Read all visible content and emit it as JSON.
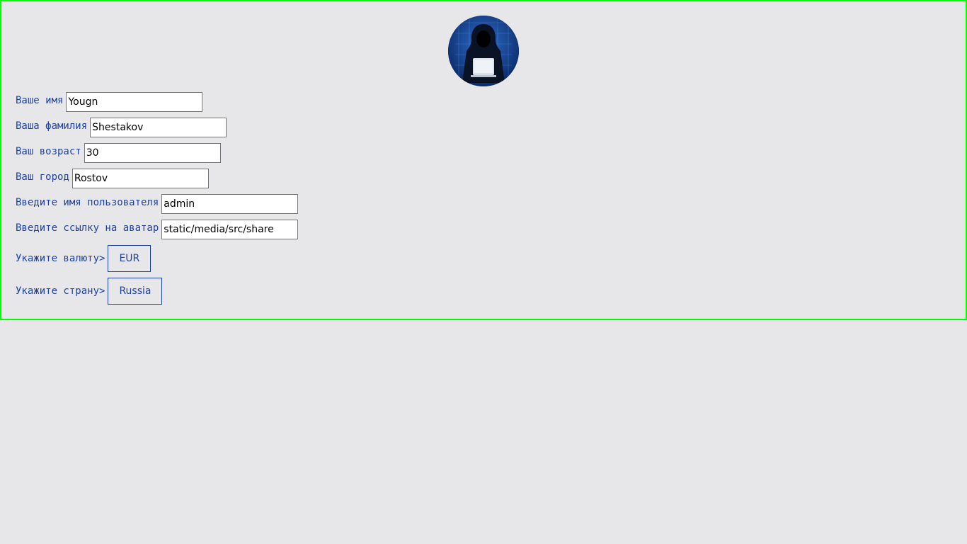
{
  "avatar": {
    "icon": "hacker-avatar-icon"
  },
  "form": {
    "fields": [
      {
        "label": "Ваше имя",
        "value": "Yougn"
      },
      {
        "label": "Ваша фамилия",
        "value": "Shestakov"
      },
      {
        "label": "Ваш возраст",
        "value": "30"
      },
      {
        "label": "Ваш город",
        "value": "Rostov"
      },
      {
        "label": "Введите имя пользователя",
        "value": "admin"
      },
      {
        "label": "Введите ссылку на аватар",
        "value": "static/media/src/share"
      }
    ],
    "currency": {
      "label": "Укажите валюту>",
      "value": "EUR"
    },
    "country": {
      "label": "Укажите страну>",
      "value": "Russia"
    }
  },
  "colors": {
    "frame": "#00ff00",
    "accent": "#1e42a3",
    "background": "#e7e7ea"
  }
}
